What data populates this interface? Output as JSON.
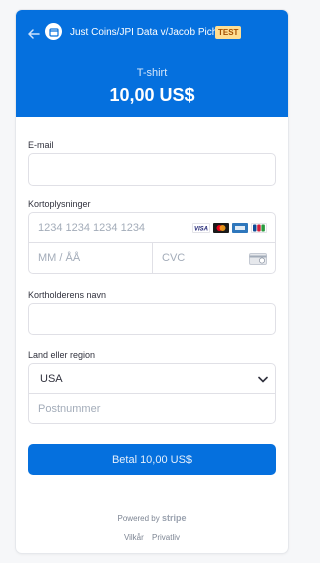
{
  "header": {
    "store_title": "Just Coins/JPI Data v/Jacob Picht",
    "test_badge": "TEST",
    "product_name": "T-shirt",
    "price": "10,00 US$"
  },
  "form": {
    "email_label": "E-mail",
    "card_label": "Kortoplysninger",
    "card_number_placeholder": "1234 1234 1234 1234",
    "expiry_placeholder": "MM / ÅÅ",
    "cvc_placeholder": "CVC",
    "cardholder_label": "Kortholderens navn",
    "country_label": "Land eller region",
    "country_value": "USA",
    "postal_placeholder": "Postnummer",
    "card_brands": [
      "visa-icon",
      "mastercard-icon",
      "amex-icon",
      "jcb-icon"
    ],
    "visa_text": "VISA"
  },
  "pay_button": "Betal 10,00 US$",
  "footer": {
    "powered_by": "Powered by",
    "stripe": "stripe",
    "terms": "Vilkår",
    "privacy": "Privatliv"
  },
  "colors": {
    "brand": "#0570de",
    "test_badge_bg": "#ffde92"
  }
}
